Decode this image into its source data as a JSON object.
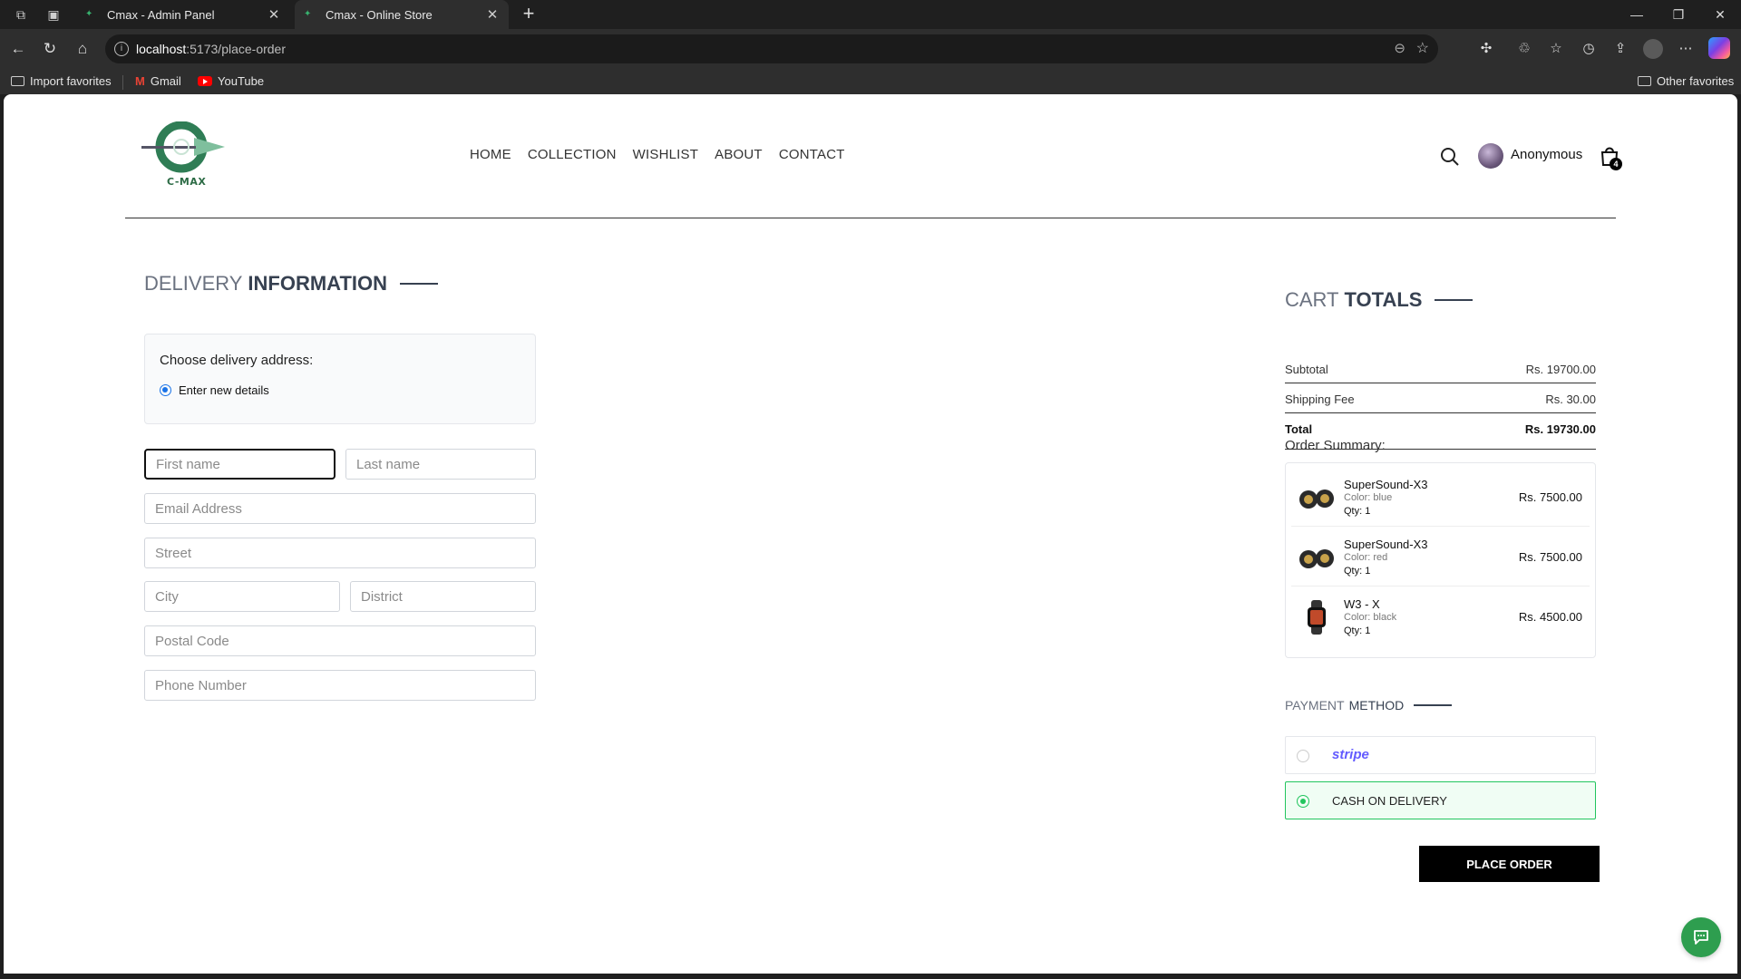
{
  "browser": {
    "tabs": [
      {
        "title": "Cmax - Admin Panel",
        "active": false
      },
      {
        "title": "Cmax - Online Store",
        "active": true
      }
    ],
    "url_host": "localhost",
    "url_path": ":5173/place-order",
    "favorites": [
      {
        "label": "Import favorites",
        "icon": "import-icon"
      },
      {
        "label": "Gmail",
        "icon": "gmail-icon"
      },
      {
        "label": "YouTube",
        "icon": "youtube-icon"
      }
    ],
    "other_favorites": "Other favorites"
  },
  "header": {
    "logo_text": "C-MAX",
    "nav": [
      "HOME",
      "COLLECTION",
      "WISHLIST",
      "ABOUT",
      "CONTACT"
    ],
    "username": "Anonymous",
    "cart_count": "4"
  },
  "delivery": {
    "title_light": "DELIVERY",
    "title_bold": "INFORMATION",
    "choose_label": "Choose delivery address:",
    "option_label": "Enter new details",
    "fields": {
      "first_name": "First name",
      "last_name": "Last name",
      "email": "Email Address",
      "street": "Street",
      "city": "City",
      "district": "District",
      "postal": "Postal Code",
      "phone": "Phone Number"
    }
  },
  "cart": {
    "title_light": "CART",
    "title_bold": "TOTALS",
    "subtotal_label": "Subtotal",
    "subtotal": "Rs. 19700.00",
    "shipping_label": "Shipping Fee",
    "shipping": "Rs. 30.00",
    "total_label": "Total",
    "total": "Rs. 19730.00",
    "summary_label": "Order Summary:",
    "items": [
      {
        "name": "SuperSound-X3",
        "color": "Color: blue",
        "qty": "Qty: 1",
        "price": "Rs. 7500.00",
        "icon": "speaker-icon"
      },
      {
        "name": "SuperSound-X3",
        "color": "Color: red",
        "qty": "Qty: 1",
        "price": "Rs. 7500.00",
        "icon": "speaker-icon"
      },
      {
        "name": "W3 - X",
        "color": "Color: black",
        "qty": "Qty: 1",
        "price": "Rs. 4500.00",
        "icon": "smartwatch-icon"
      }
    ]
  },
  "payment": {
    "title_light": "PAYMENT",
    "title_bold": "METHOD",
    "stripe": "stripe",
    "cod": "CASH ON DELIVERY",
    "selected": "cod"
  },
  "place_order": "PLACE ORDER",
  "colors": {
    "accent_green": "#22c55e",
    "stripe_purple": "#635bff",
    "radio_blue": "#1a73e8"
  }
}
